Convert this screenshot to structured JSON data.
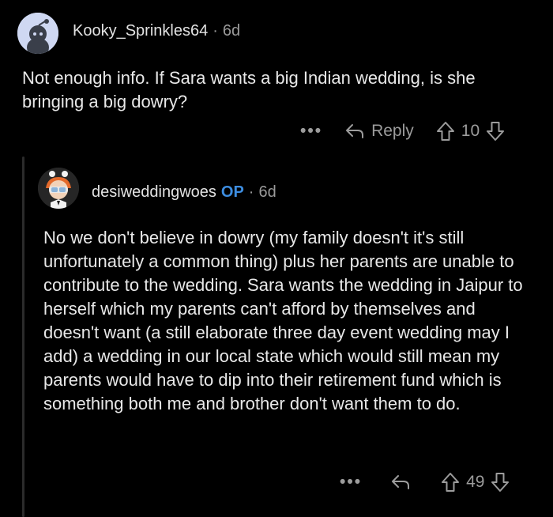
{
  "comment1": {
    "username": "Kooky_Sprinkles64",
    "time": "6d",
    "text": "Not enough info.  If Sara wants a big Indian wedding, is she bringing a big dowry?",
    "more": "•••",
    "reply_label": "Reply",
    "votes": "10"
  },
  "comment2": {
    "username": "desiweddingwoes",
    "op_badge": "OP",
    "time": "6d",
    "text": "No we don't believe in dowry (my family doesn't it's still unfortunately a common thing) plus her parents are unable to contribute to the wedding. Sara wants the wedding in Jaipur to herself which my parents can't afford by themselves and doesn't want (a still elaborate three day event wedding may I add) a wedding in our local state which would still mean my parents would have to dip into their retirement fund which is something both me and brother don't want them to do.",
    "more": "•••",
    "votes": "49"
  },
  "icons": {
    "reply": "reply-arrow-icon",
    "upvote": "upvote-icon",
    "downvote": "downvote-icon"
  },
  "colors": {
    "background": "#000000",
    "text": "#e8e8e8",
    "muted": "#9c9c9c",
    "op_blue": "#3d8de0"
  }
}
